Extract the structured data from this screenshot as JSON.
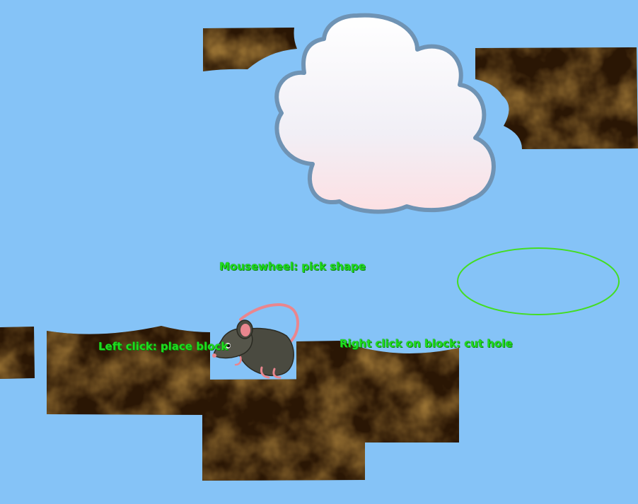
{
  "game": {
    "hints": {
      "mousewheel": "Mousewheel: pick shape",
      "left_click": "Left click: place block",
      "right_click": "Right click on block: cut hole"
    },
    "cursor_shape": "ellipse",
    "colors": {
      "sky": "#85c3f7",
      "dirt_dark": "#2a1604",
      "dirt_light": "#6e3c0c",
      "cloud_fill_top": "#ffffff",
      "cloud_fill_bottom": "#fde0e3",
      "cloud_outline": "#6f93b4",
      "hint_text": "#1fdc1f",
      "cursor_outline": "#44dd22",
      "mouse_body": "#4a4a40",
      "mouse_pink": "#e9868e"
    },
    "sprites": [
      "mouse-character",
      "cloud"
    ]
  }
}
